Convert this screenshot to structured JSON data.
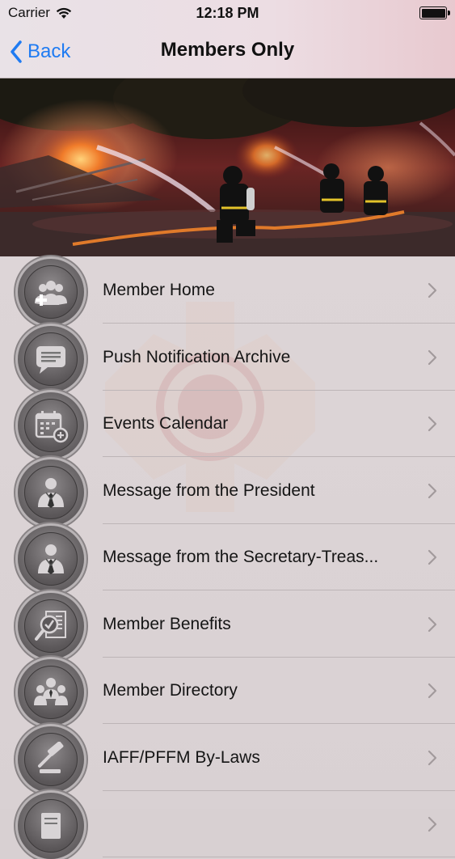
{
  "status": {
    "carrier": "Carrier",
    "time": "12:18 PM"
  },
  "nav": {
    "back_label": "Back",
    "title": "Members Only"
  },
  "menu": [
    {
      "label": "Member Home",
      "icon": "members-add-icon"
    },
    {
      "label": "Push Notification Archive",
      "icon": "chat-bubble-icon"
    },
    {
      "label": "Events Calendar",
      "icon": "calendar-add-icon"
    },
    {
      "label": "Message from the President",
      "icon": "person-tie-icon"
    },
    {
      "label": "Message from the Secretary-Treas...",
      "icon": "person-tie-icon"
    },
    {
      "label": "Member Benefits",
      "icon": "document-search-icon"
    },
    {
      "label": "Member Directory",
      "icon": "group-icon"
    },
    {
      "label": "IAFF/PFFM By-Laws",
      "icon": "gavel-icon"
    },
    {
      "label": "",
      "icon": "document-icon"
    }
  ],
  "colors": {
    "accent": "#1f7bf2",
    "chevron": "#a29a9c"
  }
}
